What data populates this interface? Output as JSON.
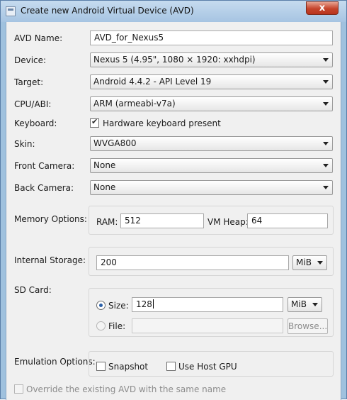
{
  "window": {
    "title": "Create new Android Virtual Device (AVD)",
    "close_label": "x"
  },
  "form": {
    "avd_name": {
      "label": "AVD Name:",
      "value": "AVD_for_Nexus5"
    },
    "device": {
      "label": "Device:",
      "value": "Nexus 5 (4.95\", 1080 × 1920: xxhdpi)"
    },
    "target": {
      "label": "Target:",
      "value": "Android 4.4.2 - API Level 19"
    },
    "cpu_abi": {
      "label": "CPU/ABI:",
      "value": "ARM (armeabi-v7a)"
    },
    "keyboard": {
      "label": "Keyboard:",
      "checkbox_label": "Hardware keyboard present",
      "checked": true
    },
    "skin": {
      "label": "Skin:",
      "value": "WVGA800"
    },
    "front_camera": {
      "label": "Front Camera:",
      "value": "None"
    },
    "back_camera": {
      "label": "Back Camera:",
      "value": "None"
    },
    "memory": {
      "label": "Memory Options:",
      "ram_label": "RAM:",
      "ram_value": "512",
      "vm_heap_label": "VM Heap:",
      "vm_heap_value": "64"
    },
    "internal_storage": {
      "label": "Internal Storage:",
      "value": "200",
      "unit": "MiB"
    },
    "sd_card": {
      "label": "SD Card:",
      "size_label": "Size:",
      "size_value": "128",
      "size_unit": "MiB",
      "file_label": "File:",
      "file_value": "",
      "browse_label": "Browse..."
    },
    "emulation": {
      "label": "Emulation Options:",
      "snapshot_label": "Snapshot",
      "host_gpu_label": "Use Host GPU"
    },
    "override": {
      "label": "Override the existing AVD with the same name"
    }
  }
}
